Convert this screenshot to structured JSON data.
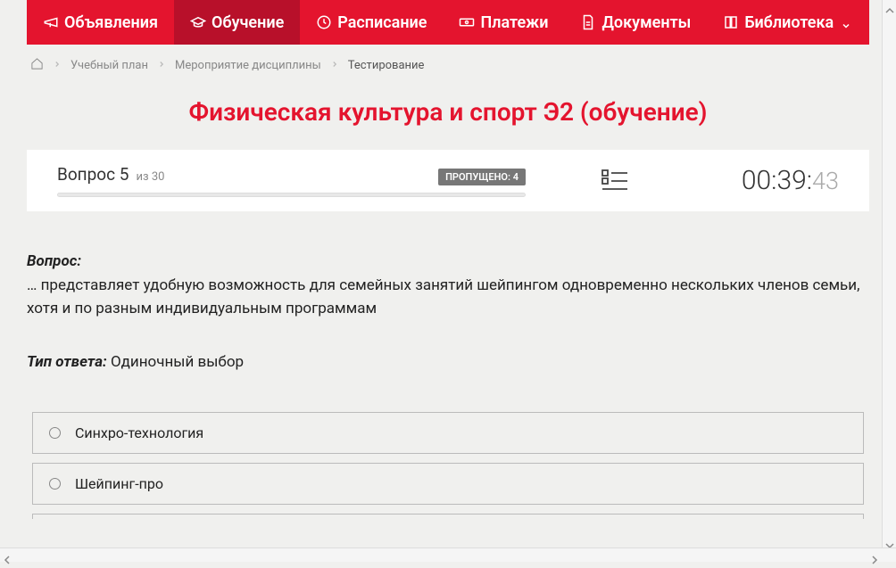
{
  "nav": {
    "items": [
      {
        "label": "Объявления",
        "icon": "megaphone-icon",
        "active": false
      },
      {
        "label": "Обучение",
        "icon": "graduation-cap-icon",
        "active": true
      },
      {
        "label": "Расписание",
        "icon": "clock-icon",
        "active": false
      },
      {
        "label": "Платежи",
        "icon": "banknote-icon",
        "active": false
      },
      {
        "label": "Документы",
        "icon": "file-text-icon",
        "active": false
      },
      {
        "label": "Библиотека",
        "icon": "book-icon",
        "active": false,
        "dropdown": true
      }
    ]
  },
  "breadcrumb": {
    "items": [
      {
        "label": "Учебный план",
        "link": true
      },
      {
        "label": "Мероприятие дисциплины",
        "link": true
      },
      {
        "label": "Тестирование",
        "link": false
      }
    ]
  },
  "page_title": "Физическая культура и спорт Э2 (обучение)",
  "status": {
    "question_label": "Вопрос 5",
    "of_label": "из 30",
    "skipped_label": "ПРОПУЩЕНО: 4",
    "timer_main": "00:39:",
    "timer_seconds": "43"
  },
  "question": {
    "heading": "Вопрос:",
    "text": "… представляет удобную возможность для семейных занятий шейпингом одновременно нескольких членов семьи, хотя и по разным индивидуальным программам",
    "answer_type_label": "Тип ответа:",
    "answer_type_value": " Одиночный выбор"
  },
  "answers": [
    {
      "text": "Синхро-технология"
    },
    {
      "text": "Шейпинг-про"
    }
  ]
}
